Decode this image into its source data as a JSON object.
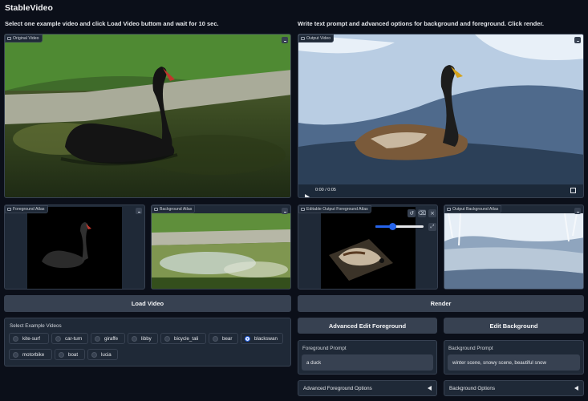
{
  "app": {
    "title": "StableVideo"
  },
  "left": {
    "instruction": "Select one example video and click Load Video buttom and wait for 10 sec.",
    "original_video_label": "Original Video",
    "foreground_atlas_label": "Foreground Atlas",
    "background_atlas_label": "Background Atlas",
    "load_button": "Load Video",
    "examples_label": "Select Example Videos",
    "examples": [
      {
        "label": "kite-surf",
        "selected": false
      },
      {
        "label": "car-turn",
        "selected": false
      },
      {
        "label": "giraffe",
        "selected": false
      },
      {
        "label": "libby",
        "selected": false
      },
      {
        "label": "bicycle_tali",
        "selected": false
      },
      {
        "label": "bear",
        "selected": false
      },
      {
        "label": "blackswan",
        "selected": true
      },
      {
        "label": "motorbike",
        "selected": false
      },
      {
        "label": "boat",
        "selected": false
      },
      {
        "label": "lucia",
        "selected": false
      }
    ]
  },
  "right": {
    "instruction": "Write text prompt and advanced options for background and foreground. Click render.",
    "output_video_label": "Output Video",
    "player_time": "0:00 / 0:05",
    "editable_fg_label": "Editable Output Foreground Atlas",
    "output_bg_label": "Output Background Atlas",
    "render_button": "Render",
    "advanced_edit_fg_button": "Advanced Edit Foreground",
    "edit_bg_button": "Edit Background",
    "fg_prompt_label": "Foreground Prompt",
    "fg_prompt_value": "a duck",
    "bg_prompt_label": "Background Prompt",
    "bg_prompt_value": "winter scene, snowy scene, beautiful snow",
    "adv_fg_options": "Advanced Foreground Options",
    "bg_options": "Background Options"
  },
  "colors": {
    "page_bg": "#0b0f19",
    "panel": "#1f2937",
    "button": "#374151",
    "accent": "#2563eb"
  },
  "icons": [
    "video-icon",
    "image-icon",
    "download-icon",
    "play-icon",
    "fullscreen-icon",
    "undo-icon",
    "clear-icon",
    "close-icon",
    "expand-icon",
    "triangle-left-icon"
  ]
}
